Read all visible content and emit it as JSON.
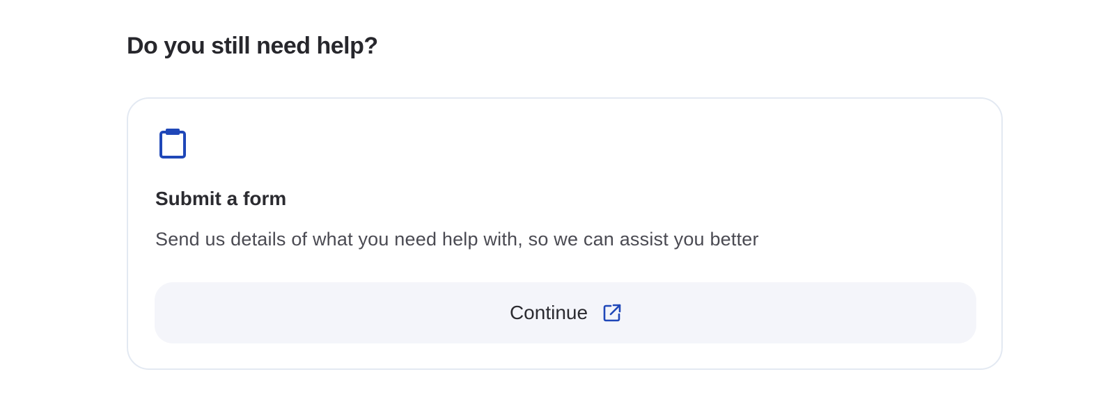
{
  "help": {
    "heading": "Do you still need help?"
  },
  "form_card": {
    "icon": "clipboard-icon",
    "title": "Submit a form",
    "description": "Send us details of what you need help with, so we can assist you better",
    "button_label": "Continue",
    "button_icon": "external-link-icon"
  },
  "colors": {
    "accent": "#1f47b8",
    "card_border": "#e3e9f2",
    "button_bg": "#f4f5fa"
  }
}
